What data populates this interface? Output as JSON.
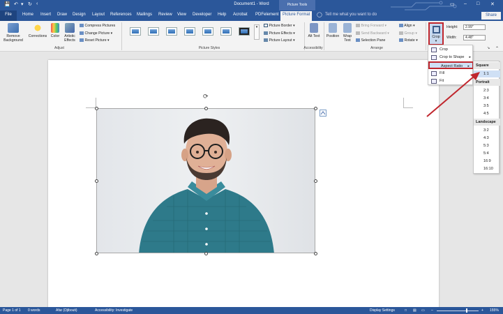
{
  "title_bar": {
    "document_title": "Document1  -  Word",
    "context_tab": "Picture Tools",
    "quick_access": [
      "save-icon",
      "undo-icon",
      "redo-icon",
      "customize-icon"
    ]
  },
  "tabs": {
    "file": "File",
    "items": [
      "Home",
      "Insert",
      "Draw",
      "Design",
      "Layout",
      "References",
      "Mailings",
      "Review",
      "View",
      "Developer",
      "Help",
      "Acrobat",
      "PDFelement",
      "Picture Format"
    ],
    "active": "Picture Format",
    "tell_me": "Tell me what you want to do",
    "share": "Share"
  },
  "ribbon": {
    "adjust": {
      "label": "Adjust",
      "remove_background": "Remove Background",
      "corrections": "Corrections",
      "color": "Color",
      "artistic_effects": "Artistic Effects",
      "compress": "Compress Pictures",
      "change": "Change Picture",
      "reset": "Reset Picture"
    },
    "picture_styles": {
      "label": "Picture Styles",
      "border": "Picture Border",
      "effects": "Picture Effects",
      "layout": "Picture Layout"
    },
    "accessibility": {
      "label": "Accessibility",
      "alt_text": "Alt Text"
    },
    "arrange": {
      "label": "Arrange",
      "position": "Position",
      "wrap_text": "Wrap Text",
      "bring_forward": "Bring Forward",
      "send_backward": "Send Backward",
      "selection_pane": "Selection Pane",
      "align": "Align",
      "group": "Group",
      "rotate": "Rotate"
    },
    "size": {
      "crop": "Crop",
      "height_label": "Height:",
      "height_value": "2.99\"",
      "width_label": "Width:",
      "width_value": "4.48\""
    }
  },
  "crop_menu": {
    "items": [
      "Crop",
      "Crop to Shape",
      "Aspect Ratio",
      "Fill",
      "Fit"
    ]
  },
  "aspect_ratio_menu": {
    "square_header": "Square",
    "square": [
      "1:1"
    ],
    "portrait_header": "Portrait",
    "portrait": [
      "2:3",
      "3:4",
      "3:5",
      "4:5"
    ],
    "landscape_header": "Landscape",
    "landscape": [
      "3:2",
      "4:3",
      "5:3",
      "5:4",
      "16:9",
      "16:10"
    ],
    "highlighted": "1:1"
  },
  "status_bar": {
    "page": "Page 1 of 1",
    "words": "0 words",
    "language": "Afar (Djibouti)",
    "accessibility": "Accessibility: Investigate",
    "display_settings": "Display Settings",
    "zoom": "155%"
  },
  "colors": {
    "word_blue": "#2b579a",
    "highlight_red": "#c0262d",
    "shirt": "#2e7a8a"
  }
}
